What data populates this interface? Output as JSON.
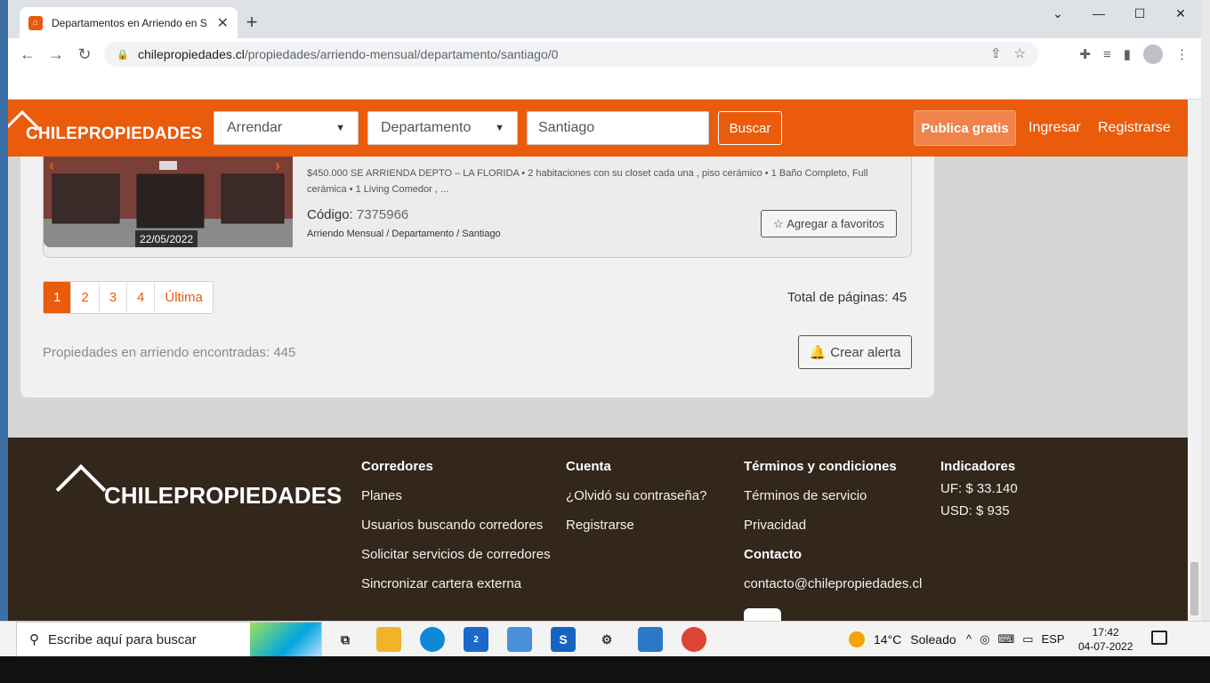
{
  "browser": {
    "tab_title": "Departamentos en Arriendo en S",
    "url_domain": "chilepropiedades.cl",
    "url_path": "/propiedades/arriendo-mensual/departamento/santiago/0"
  },
  "header": {
    "logo_light": "CHILE",
    "logo_bold": "PROPIEDADES",
    "operation_value": "Arrendar",
    "type_value": "Departamento",
    "location_value": "Santiago",
    "search_label": "Buscar",
    "publish_label": "Publica gratis",
    "login_label": "Ingresar",
    "register_label": "Registrarse"
  },
  "listing": {
    "date": "22/05/2022",
    "description": "$450.000 SE ARRIENDA DEPTO – LA FLORIDA • 2 habitaciones con su closet cada una , piso cerámico • 1 Baño Completo, Full cerámica • 1 Living Comedor , ...",
    "code_label": "Código:",
    "code_value": "7375966",
    "category": "Arriendo Mensual / Departamento / Santiago",
    "favorite_label": "Agregar a favoritos"
  },
  "pagination": {
    "pages": [
      "1",
      "2",
      "3",
      "4"
    ],
    "last_label": "Última",
    "total_label": "Total de páginas: 45"
  },
  "results": {
    "found_label": "Propiedades en arriendo encontradas: 445",
    "alert_label": "Crear alerta"
  },
  "footer": {
    "col1": {
      "title": "Corredores",
      "links": [
        "Planes",
        "Usuarios buscando corredores",
        "Solicitar servicios de corredores",
        "Sincronizar cartera externa"
      ]
    },
    "col2": {
      "title": "Cuenta",
      "links": [
        "¿Olvidó su contraseña?",
        "Registrarse"
      ]
    },
    "col3": {
      "title": "Términos y condiciones",
      "links": [
        "Términos de servicio",
        "Privacidad"
      ],
      "contact_title": "Contacto",
      "contact_email": "contacto@chilepropiedades.cl"
    },
    "col4": {
      "title": "Indicadores",
      "uf": "UF: $ 33.140",
      "usd": "USD: $ 935"
    }
  },
  "taskbar": {
    "search_placeholder": "Escribe aquí para buscar",
    "mail_badge": "2",
    "weather_temp": "14°C",
    "weather_text": "Soleado",
    "lang": "ESP",
    "time": "17:42",
    "date": "04-07-2022"
  },
  "colors": {
    "brand": "#ea5b0c",
    "footer_bg": "#33261b"
  }
}
